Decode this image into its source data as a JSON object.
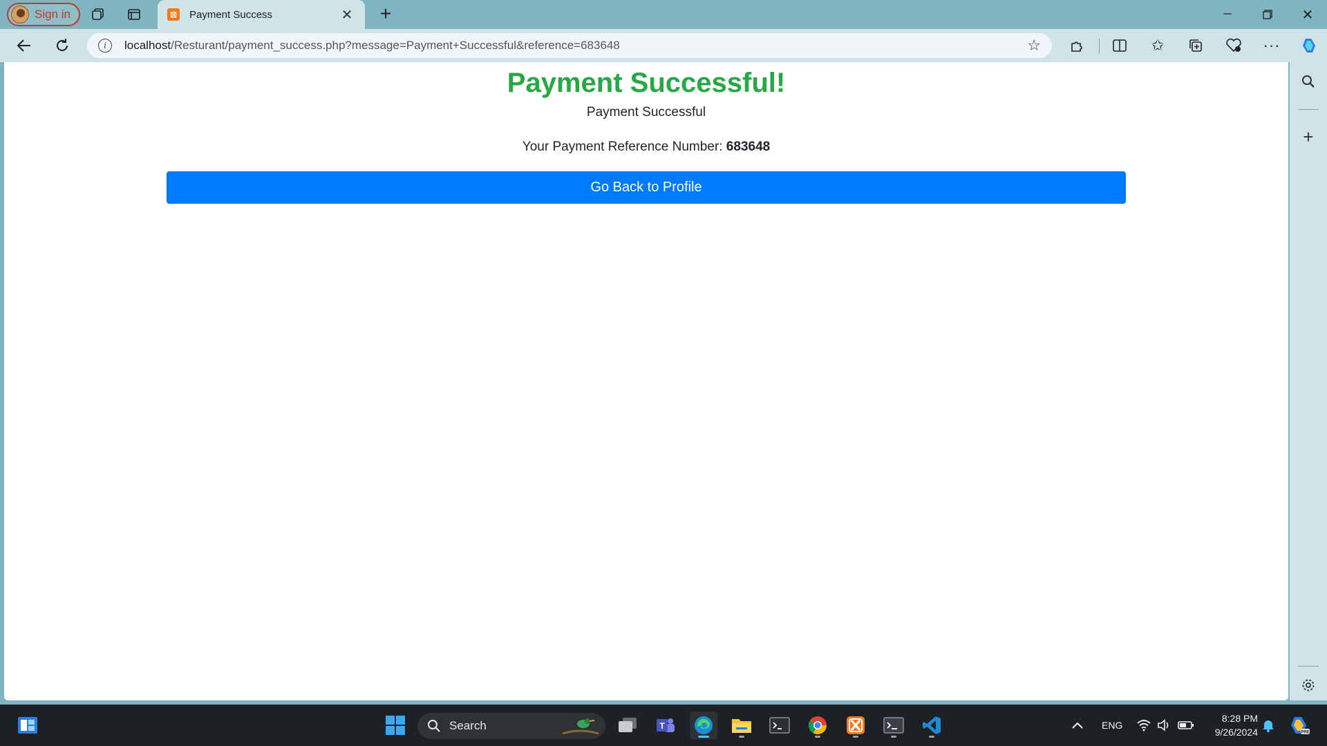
{
  "browser": {
    "profile_label": "Sign in",
    "tab_title": "Payment Success",
    "url_host": "localhost",
    "url_path": "/Resturant/payment_success.php?message=Payment+Successful&reference=683648"
  },
  "page": {
    "heading": "Payment Successful!",
    "message": "Payment Successful",
    "reference_label": "Your Payment Reference Number:",
    "reference_number": "683648",
    "back_button_label": "Go Back to Profile"
  },
  "taskbar": {
    "search_label": "Search",
    "language": "ENG",
    "time": "8:28 PM",
    "date": "9/26/2024"
  },
  "colors": {
    "heading_green": "#28a745",
    "button_blue": "#007bff",
    "browser_frame": "#7fb4c0",
    "taskbar_bg": "#1d2024"
  },
  "icons": [
    "avatar-icon",
    "workspaces-icon",
    "tab-actions-icon",
    "xampp-favicon",
    "close-icon",
    "new-tab-icon",
    "minimize-icon",
    "restore-icon",
    "window-close-icon",
    "back-icon",
    "refresh-icon",
    "info-icon",
    "favorite-star-icon",
    "extensions-icon",
    "split-screen-icon",
    "favorites-icon",
    "collections-icon",
    "browser-essentials-icon",
    "more-icon",
    "copilot-icon",
    "sidebar-search-icon",
    "sidebar-add-icon",
    "sidebar-settings-icon",
    "start-icon",
    "task-view-icon",
    "teams-icon",
    "edge-icon",
    "file-explorer-icon",
    "terminal-icon",
    "chrome-icon",
    "xampp-icon",
    "vscode-icon",
    "chevron-up-icon",
    "wifi-icon",
    "volume-icon",
    "battery-icon",
    "notification-icon",
    "copilot-taskbar-icon"
  ]
}
